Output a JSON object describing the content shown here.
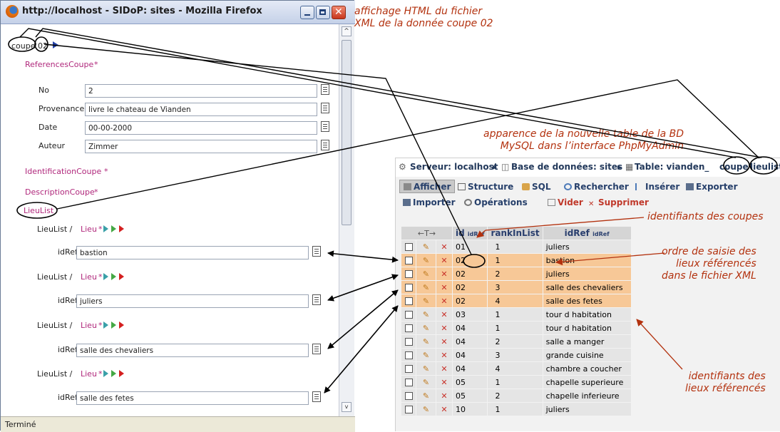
{
  "firefox": {
    "title": "http://localhost - SIDoP: sites - Mozilla Firefox",
    "status": "Terminé",
    "root": {
      "tag": "coupe",
      "id": "02"
    },
    "references_section": "ReferencesCoupe",
    "fields": [
      {
        "label": "No",
        "value": "2"
      },
      {
        "label": "Provenance",
        "value": "livre le chateau de Vianden"
      },
      {
        "label": "Date",
        "value": "00-00-2000"
      },
      {
        "label": "Auteur",
        "value": "Zimmer"
      }
    ],
    "identification_section": "IdentificationCoupe",
    "description_section": "DescriptionCoupe",
    "asterisk": "*",
    "lieulist_label": "LieuList",
    "lieu_path": "LieuList /",
    "lieu_label": "Lieu",
    "idref_label": "idRef",
    "lieux": [
      {
        "idref": "bastion"
      },
      {
        "idref": "juliers"
      },
      {
        "idref": "salle des chevaliers"
      },
      {
        "idref": "salle des fetes"
      }
    ]
  },
  "phpmyadmin": {
    "breadcrumb": {
      "server": "Serveur: localhost",
      "database": "Base de données: sites",
      "table_prefix": "Table: vianden_",
      "table_coupe": "coupe",
      "table_lieulist": "lieulist"
    },
    "tabs_row1": [
      "Afficher",
      "Structure",
      "SQL",
      "Rechercher",
      "Insérer",
      "Exporter"
    ],
    "tabs_row2": [
      "Importer",
      "Opérations",
      "Vider",
      "Supprimer"
    ],
    "columns": {
      "arrows": "←T→",
      "id": "id",
      "id_sub": "idRef",
      "rank": "rankInList",
      "idref": "idRef",
      "idref_sub": "idRef"
    },
    "rows": [
      {
        "id": "01",
        "rank": "1",
        "idref": "juliers",
        "highlight": false
      },
      {
        "id": "02",
        "rank": "1",
        "idref": "bastion",
        "highlight": true
      },
      {
        "id": "02",
        "rank": "2",
        "idref": "juliers",
        "highlight": true
      },
      {
        "id": "02",
        "rank": "3",
        "idref": "salle des chevaliers",
        "highlight": true
      },
      {
        "id": "02",
        "rank": "4",
        "idref": "salle des fetes",
        "highlight": true
      },
      {
        "id": "03",
        "rank": "1",
        "idref": "tour d habitation",
        "highlight": false
      },
      {
        "id": "04",
        "rank": "1",
        "idref": "tour d habitation",
        "highlight": false
      },
      {
        "id": "04",
        "rank": "2",
        "idref": "salle a manger",
        "highlight": false
      },
      {
        "id": "04",
        "rank": "3",
        "idref": "grande cuisine",
        "highlight": false
      },
      {
        "id": "04",
        "rank": "4",
        "idref": "chambre a coucher",
        "highlight": false
      },
      {
        "id": "05",
        "rank": "1",
        "idref": "chapelle superieure",
        "highlight": false
      },
      {
        "id": "05",
        "rank": "2",
        "idref": "chapelle inferieure",
        "highlight": false
      },
      {
        "id": "10",
        "rank": "1",
        "idref": "juliers",
        "highlight": false
      }
    ],
    "highlight_color": "#f7c897"
  },
  "annotations": {
    "html_display": [
      "affichage HTML du fichier",
      "XML de la donnée coupe 02"
    ],
    "new_table": [
      "apparence de la nouvelle table de la BD",
      "MySQL dans l’interface PhpMyAdmin"
    ],
    "coupe_ids": "identifiants des coupes",
    "order": [
      "ordre de saisie des",
      "lieux référencés",
      "dans le fichier XML"
    ],
    "lieu_ids": [
      "identifiants des",
      "lieux référencés"
    ],
    "color": "#b3320f"
  }
}
